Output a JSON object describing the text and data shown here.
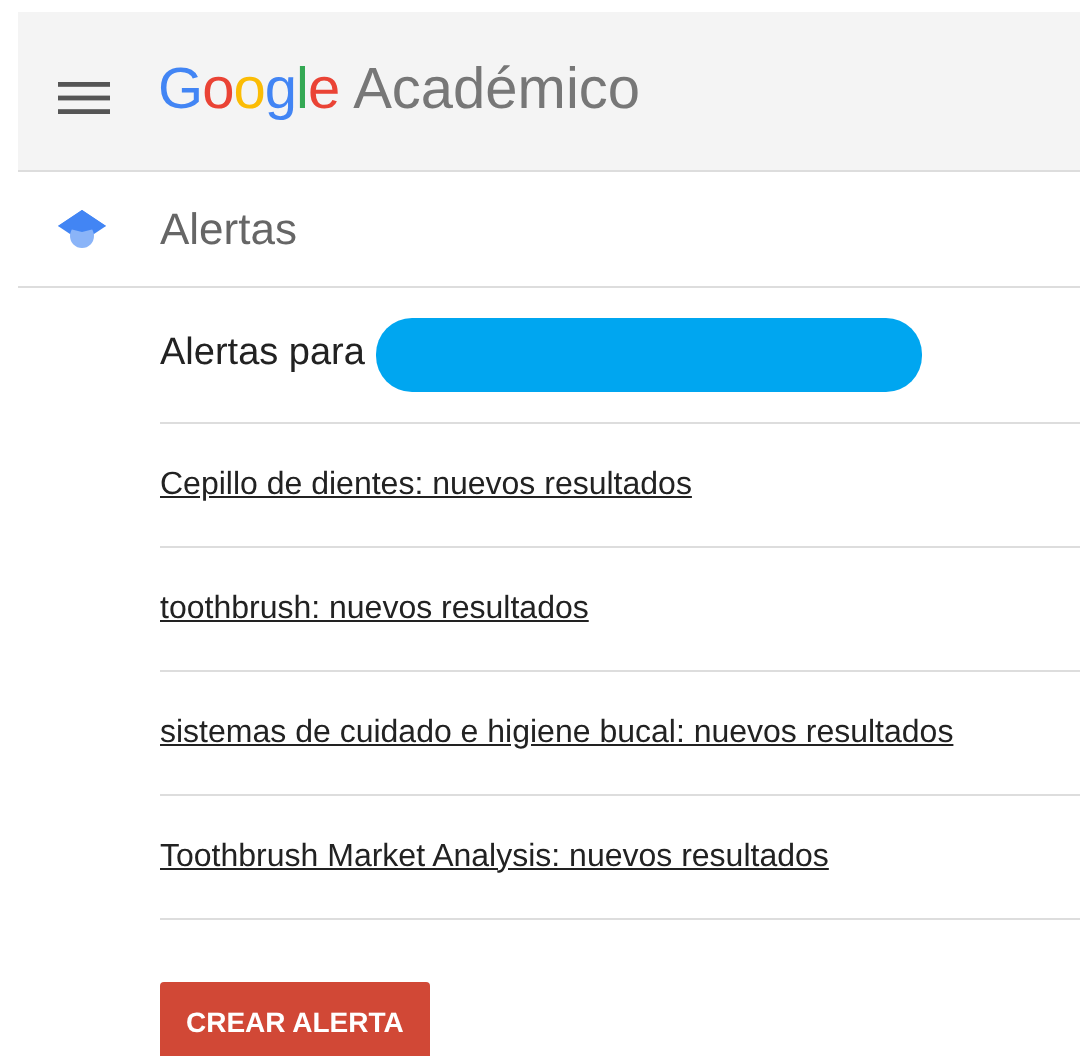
{
  "header": {
    "logo": "Google",
    "product": "Académico"
  },
  "section": {
    "title": "Alertas"
  },
  "recipient": {
    "label": "Alertas para",
    "redacted": true
  },
  "alerts": [
    {
      "text": "Cepillo de dientes: nuevos resultados"
    },
    {
      "text": "toothbrush: nuevos resultados"
    },
    {
      "text": "sistemas de cuidado e higiene bucal: nuevos resultados"
    },
    {
      "text": "Toothbrush Market Analysis: nuevos resultados"
    }
  ],
  "buttons": [
    {
      "label": "CREAR ALERTA"
    }
  ]
}
